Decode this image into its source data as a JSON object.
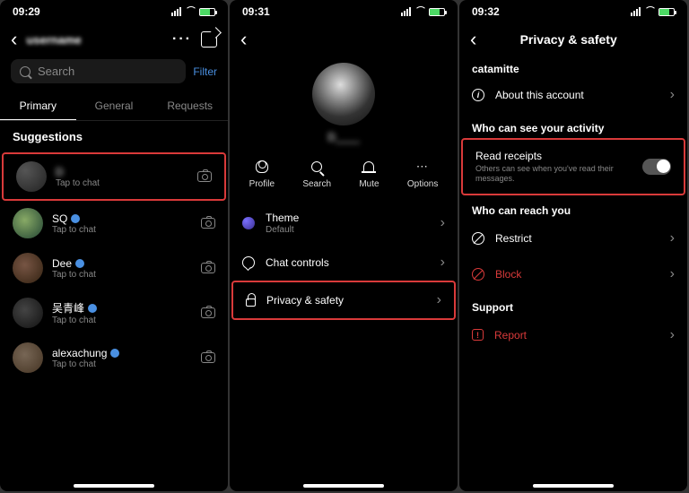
{
  "pane1": {
    "time": "09:29",
    "username": "username",
    "search_placeholder": "Search",
    "filter": "Filter",
    "tabs": {
      "primary": "Primary",
      "general": "General",
      "requests": "Requests"
    },
    "suggestions_label": "Suggestions",
    "chats": [
      {
        "name": "D",
        "sub": "Tap to chat",
        "verified": false,
        "blur": true
      },
      {
        "name": "SQ",
        "sub": "Tap to chat",
        "verified": true,
        "blur": false
      },
      {
        "name": "Dee",
        "sub": "Tap to chat",
        "verified": true,
        "blur": false
      },
      {
        "name": "吴青峰",
        "sub": "Tap to chat",
        "verified": true,
        "blur": false
      },
      {
        "name": "alexachung",
        "sub": "Tap to chat",
        "verified": true,
        "blur": false
      }
    ]
  },
  "pane2": {
    "time": "09:31",
    "profile_name": "D____",
    "actions": {
      "profile": "Profile",
      "search": "Search",
      "mute": "Mute",
      "options": "Options"
    },
    "theme_label": "Theme",
    "theme_value": "Default",
    "chat_controls": "Chat controls",
    "privacy_safety": "Privacy & safety"
  },
  "pane3": {
    "time": "09:32",
    "title": "Privacy & safety",
    "username": "catamitte",
    "about": "About this account",
    "sec_activity": "Who can see your activity",
    "read_receipts": "Read receipts",
    "read_sub": "Others can see when you've read their messages.",
    "sec_reach": "Who can reach you",
    "restrict": "Restrict",
    "block": "Block",
    "support": "Support",
    "report": "Report"
  }
}
